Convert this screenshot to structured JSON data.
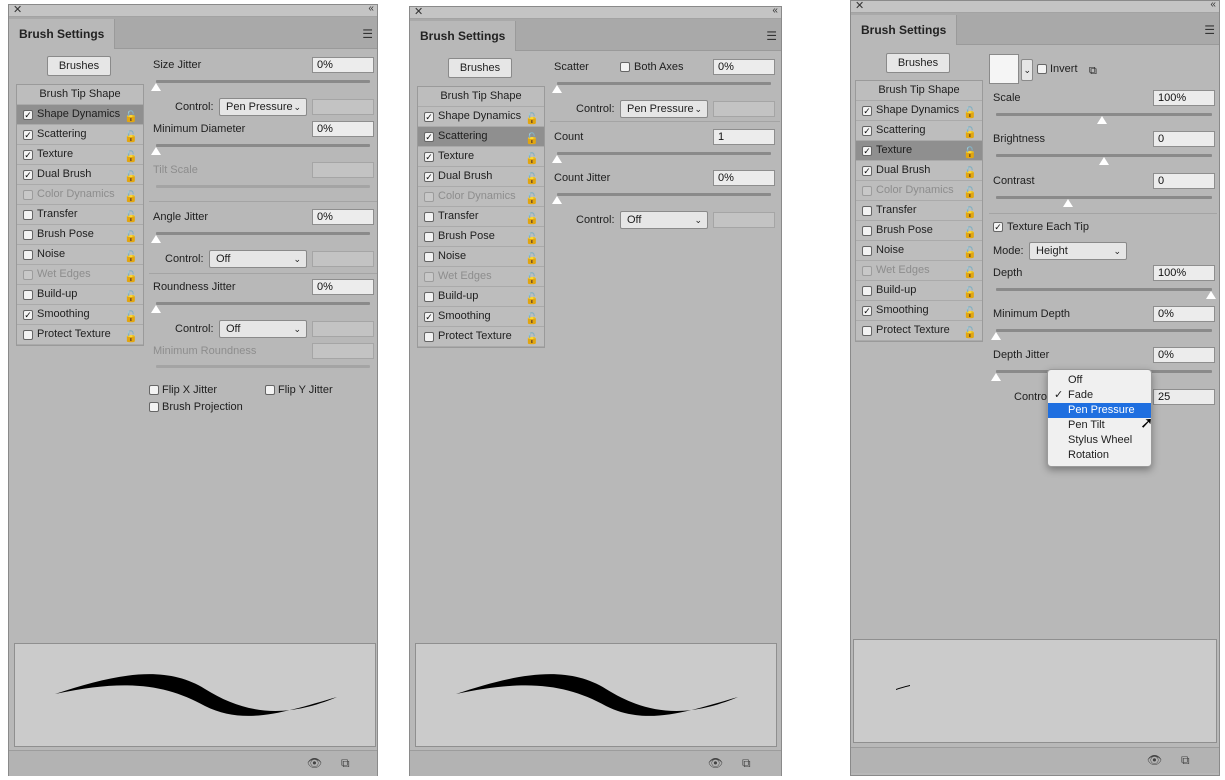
{
  "panel_title": "Brush Settings",
  "brushes_label": "Brushes",
  "list": {
    "header": "Brush Tip Shape",
    "items": [
      {
        "label": "Shape Dynamics"
      },
      {
        "label": "Scattering"
      },
      {
        "label": "Texture"
      },
      {
        "label": "Dual Brush"
      },
      {
        "label": "Color Dynamics"
      },
      {
        "label": "Transfer"
      },
      {
        "label": "Brush Pose"
      },
      {
        "label": "Noise"
      },
      {
        "label": "Wet Edges"
      },
      {
        "label": "Build-up"
      },
      {
        "label": "Smoothing"
      },
      {
        "label": "Protect Texture"
      }
    ]
  },
  "icons": {
    "close": "close-icon",
    "collapse": "collapse-icon",
    "menu": "panel-menu-icon",
    "lock": "lock-icon",
    "eye": "toggle-preview-icon",
    "new": "create-new-brush-icon"
  },
  "panel1": {
    "size_jitter": {
      "label": "Size Jitter",
      "value": "0%"
    },
    "control1": {
      "label": "Control:",
      "value": "Pen Pressure"
    },
    "min_diameter": {
      "label": "Minimum Diameter",
      "value": "0%"
    },
    "tilt_scale": {
      "label": "Tilt Scale"
    },
    "angle_jitter": {
      "label": "Angle Jitter",
      "value": "0%"
    },
    "control2": {
      "label": "Control:",
      "value": "Off"
    },
    "roundness_jitter": {
      "label": "Roundness Jitter",
      "value": "0%"
    },
    "control3": {
      "label": "Control:",
      "value": "Off"
    },
    "min_roundness": {
      "label": "Minimum Roundness"
    },
    "flip_x": "Flip X Jitter",
    "flip_y": "Flip Y Jitter",
    "brush_projection": "Brush Projection"
  },
  "panel2": {
    "scatter": {
      "label": "Scatter",
      "value": "0%"
    },
    "both_axes": "Both Axes",
    "control1": {
      "label": "Control:",
      "value": "Pen Pressure"
    },
    "count": {
      "label": "Count",
      "value": "1"
    },
    "count_jitter": {
      "label": "Count Jitter",
      "value": "0%"
    },
    "control2": {
      "label": "Control:",
      "value": "Off"
    }
  },
  "panel3": {
    "invert": "Invert",
    "scale": {
      "label": "Scale",
      "value": "100%"
    },
    "brightness": {
      "label": "Brightness",
      "value": "0"
    },
    "contrast": {
      "label": "Contrast",
      "value": "0"
    },
    "texture_each_tip": "Texture Each Tip",
    "mode": {
      "label": "Mode:",
      "value": "Height"
    },
    "depth": {
      "label": "Depth",
      "value": "100%"
    },
    "min_depth": {
      "label": "Minimum Depth",
      "value": "0%"
    },
    "depth_jitter": {
      "label": "Depth Jitter",
      "value": "0%"
    },
    "control": {
      "label": "Contro",
      "value": "25"
    },
    "dropdown": {
      "options": [
        "Off",
        "Fade",
        "Pen Pressure",
        "Pen Tilt",
        "Stylus Wheel",
        "Rotation"
      ],
      "checked": "Fade",
      "highlighted": "Pen Pressure"
    }
  }
}
